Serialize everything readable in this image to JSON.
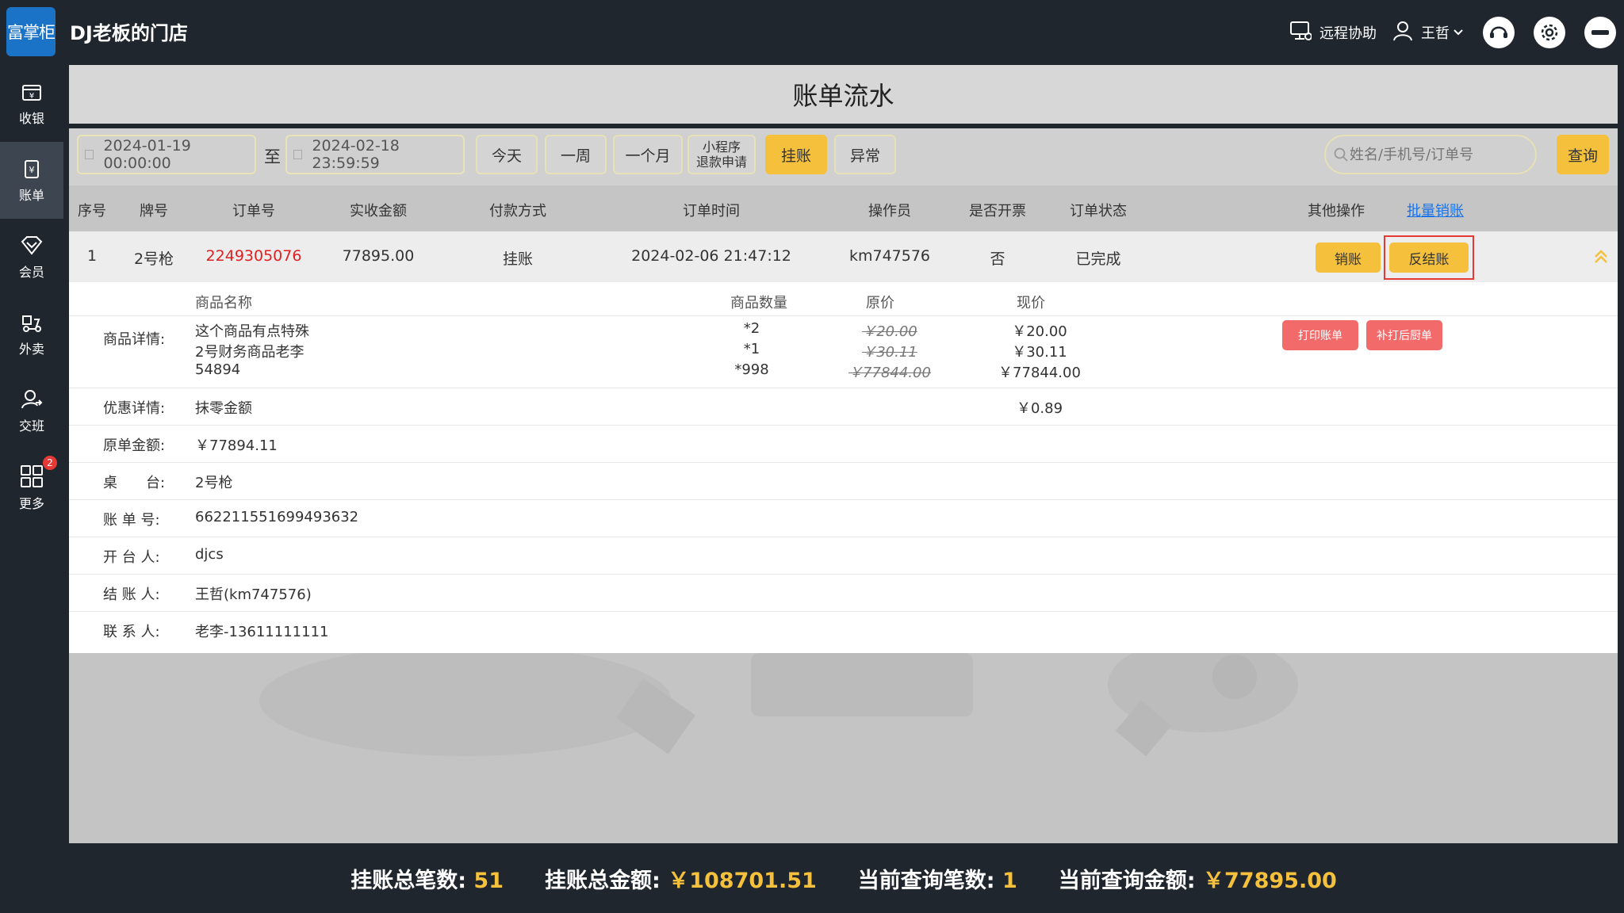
{
  "header": {
    "logo_text": "富掌柜",
    "store_name": "DJ老板的门店",
    "remote_help": "远程协助",
    "user_name": "王哲"
  },
  "sidebar": {
    "items": [
      {
        "label": "收银",
        "icon": "cashier-icon"
      },
      {
        "label": "账单",
        "icon": "bill-icon"
      },
      {
        "label": "会员",
        "icon": "member-icon"
      },
      {
        "label": "外卖",
        "icon": "takeout-icon"
      },
      {
        "label": "交班",
        "icon": "handover-icon"
      },
      {
        "label": "更多",
        "icon": "more-icon",
        "badge": "2"
      }
    ]
  },
  "page": {
    "title": "账单流水"
  },
  "filter": {
    "start_date": "2024-01-19 00:00:00",
    "to_label": "至",
    "end_date": "2024-02-18 23:59:59",
    "btn_today": "今天",
    "btn_week": "一周",
    "btn_month": "一个月",
    "btn_mini_line1": "小程序",
    "btn_mini_line2": "退款申请",
    "btn_credit": "挂账",
    "btn_abnormal": "异常",
    "search_placeholder": "姓名/手机号/订单号",
    "query": "查询"
  },
  "table": {
    "headers": {
      "seq": "序号",
      "plate": "牌号",
      "order_no": "订单号",
      "amount": "实收金额",
      "pay_method": "付款方式",
      "order_time": "订单时间",
      "operator": "操作员",
      "invoice": "是否开票",
      "status": "订单状态",
      "other_ops": "其他操作",
      "batch_writeoff": "批量销账"
    },
    "row": {
      "seq": "1",
      "plate": "2号枪",
      "order_no": "2249305076",
      "amount": "77895.00",
      "pay_method": "挂账",
      "order_time": "2024-02-06 21:47:12",
      "operator": "km747576",
      "invoice": "否",
      "status": "已完成",
      "btn_writeoff": "销账",
      "btn_reverse": "反结账"
    }
  },
  "detail": {
    "col_name": "商品名称",
    "col_qty": "商品数量",
    "col_orig": "原价",
    "col_now": "现价",
    "goods_label": "商品详情:",
    "goods": [
      {
        "name": "这个商品有点特殊",
        "qty": "*2",
        "orig": "￥20.00",
        "now": "￥20.00"
      },
      {
        "name": "2号财务商品老李",
        "qty": "*1",
        "orig": "￥30.11",
        "now": "￥30.11"
      },
      {
        "name": "54894",
        "qty": "*998",
        "orig": "￥77844.00",
        "now": "￥77844.00"
      }
    ],
    "btn_print": "打印账单",
    "btn_reprint": "补打后厨单",
    "discount_label": "优惠详情:",
    "discount_name": "抹零金额",
    "discount_value": "￥0.89",
    "orig_amount_label": "原单金额:",
    "orig_amount": "￥77894.11",
    "table_label": "桌　　台:",
    "table_value": "2号枪",
    "bill_no_label": "账 单 号:",
    "bill_no": "662211551699493632",
    "opener_label": "开 台 人:",
    "opener": "djcs",
    "settler_label": "结 账 人:",
    "settler": "王哲(km747576)",
    "contact_label": "联 系 人:",
    "contact": "老李-13611111111"
  },
  "footer": {
    "total_count_label": "挂账总笔数:",
    "total_count": "51",
    "total_amount_label": "挂账总金额:",
    "total_amount": "￥108701.51",
    "query_count_label": "当前查询笔数:",
    "query_count": "1",
    "query_amount_label": "当前查询金额:",
    "query_amount": "￥77895.00"
  },
  "colors": {
    "accent": "#f5c03b",
    "dark": "#1f262e",
    "danger": "#e53935",
    "order_no": "#e02020",
    "print_btn": "#f26a6a"
  }
}
